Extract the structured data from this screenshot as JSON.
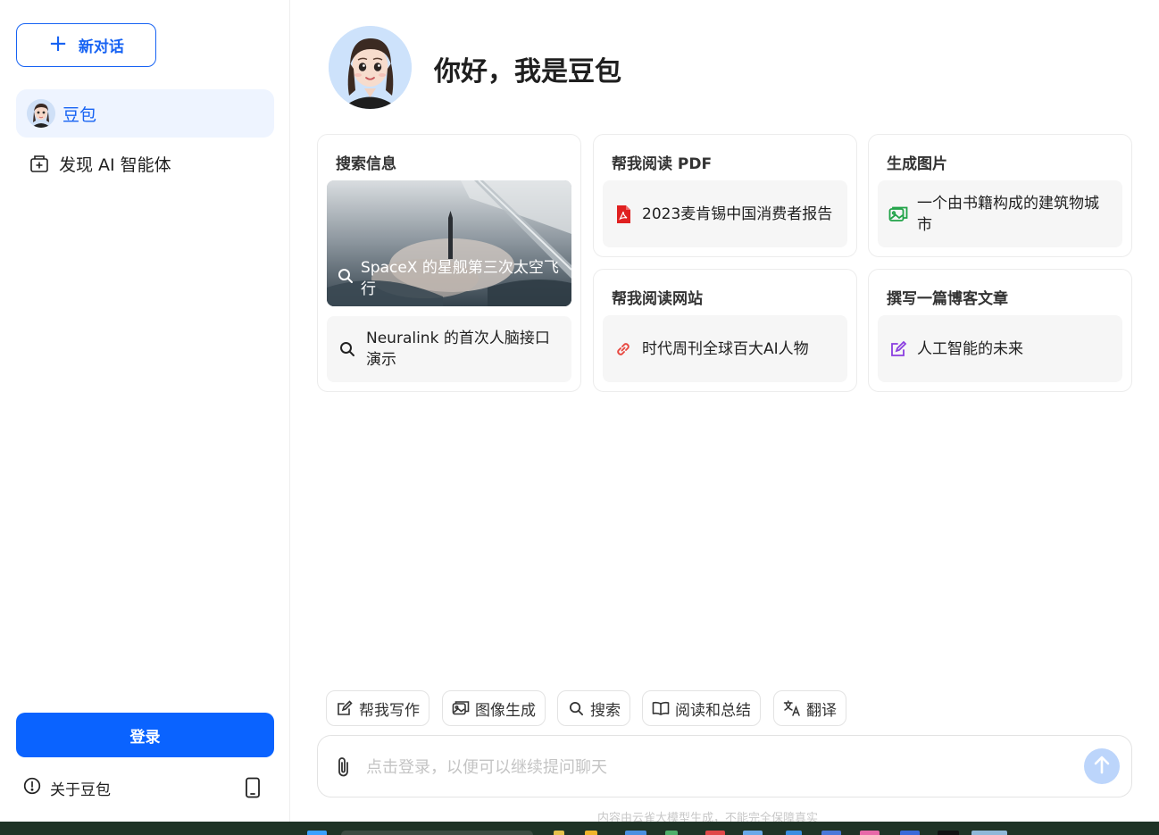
{
  "sidebar": {
    "new_chat_label": "新对话",
    "items": [
      {
        "label": "豆包",
        "active": true
      },
      {
        "label": "发现 AI 智能体",
        "active": false
      }
    ],
    "login_label": "登录",
    "about_label": "关于豆包"
  },
  "main": {
    "greeting": "你好，我是豆包",
    "cards": [
      {
        "title": "搜索信息",
        "items": [
          "SpaceX 的星舰第三次太空飞行",
          "Neuralink 的首次人脑接口演示"
        ]
      },
      {
        "title": "帮我阅读 PDF",
        "items": [
          "2023麦肯锡中国消费者报告"
        ]
      },
      {
        "title": "生成图片",
        "items": [
          "一个由书籍构成的建筑物城市"
        ]
      },
      {
        "title": "帮我阅读网站",
        "items": [
          "时代周刊全球百大AI人物"
        ]
      },
      {
        "title": "撰写一篇博客文章",
        "items": [
          "人工智能的未来"
        ]
      }
    ],
    "tools": [
      "帮我写作",
      "图像生成",
      "搜索",
      "阅读和总结",
      "翻译"
    ],
    "input": {
      "placeholder": "点击登录，以便可以继续提问聊天",
      "value": ""
    },
    "disclaimer": "内容由云雀大模型生成，不能完全保障真实"
  },
  "colors": {
    "accent": "#1763f3",
    "login_button": "#0a63ff",
    "active_nav_bg": "#eef4ff",
    "pdf_icon": "#e02020",
    "image_icon": "#21a348",
    "link_icon": "#e8473f",
    "edit_icon": "#8a3ee0"
  },
  "icons": [
    "plus-icon",
    "discover-agent-icon",
    "info-icon",
    "phone-icon",
    "search-icon",
    "pdf-icon",
    "image-icon",
    "link-icon",
    "edit-icon",
    "write-icon",
    "image-gen-icon",
    "book-icon",
    "translate-icon",
    "paperclip-icon",
    "send-arrow-icon"
  ]
}
